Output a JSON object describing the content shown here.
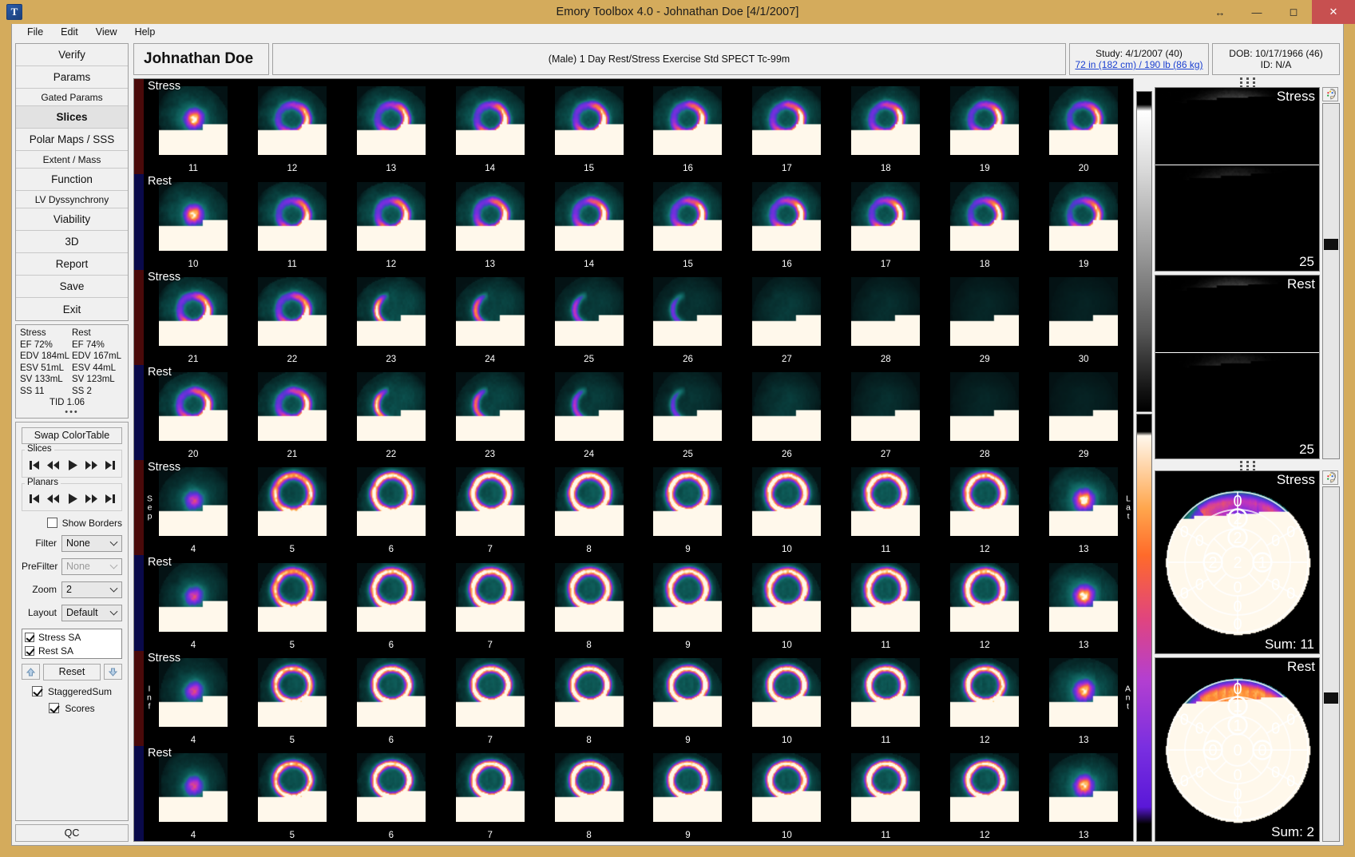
{
  "window": {
    "title": "Emory Toolbox 4.0 - Johnathan Doe [4/1/2007]",
    "app_icon": "T",
    "controls": {
      "resize": "resize-icon",
      "minimize": "minimize-icon",
      "maximize": "maximize-icon",
      "close": "close-icon"
    }
  },
  "menu": {
    "items": [
      "File",
      "Edit",
      "View",
      "Help"
    ]
  },
  "sidebar": {
    "nav": [
      {
        "label": "Verify",
        "size": "big",
        "active": false
      },
      {
        "label": "Params",
        "size": "big",
        "active": false
      },
      {
        "label": "Gated Params",
        "size": "sub",
        "active": false
      },
      {
        "label": "Slices",
        "size": "big",
        "active": true
      },
      {
        "label": "Polar Maps / SSS",
        "size": "big",
        "active": false
      },
      {
        "label": "Extent / Mass",
        "size": "sub",
        "active": false
      },
      {
        "label": "Function",
        "size": "big",
        "active": false
      },
      {
        "label": "LV Dyssynchrony",
        "size": "sub",
        "active": false
      },
      {
        "label": "Viability",
        "size": "big",
        "active": false
      },
      {
        "label": "3D",
        "size": "big",
        "active": false
      },
      {
        "label": "Report",
        "size": "big",
        "active": false
      },
      {
        "label": "Save",
        "size": "big",
        "active": false
      },
      {
        "label": "Exit",
        "size": "big",
        "active": false
      }
    ],
    "stats": {
      "col1_header": "Stress",
      "col2_header": "Rest",
      "col1": [
        "EF 72%",
        "EDV 184mL",
        "ESV 51mL",
        "SV 133mL",
        "SS 11"
      ],
      "col2": [
        "EF 74%",
        "EDV 167mL",
        "ESV 44mL",
        "SV 123mL",
        "SS 2"
      ],
      "tid": "TID 1.06",
      "more": "•••"
    },
    "controls": {
      "swap_colortable": "Swap ColorTable",
      "slices_legend": "Slices",
      "planars_legend": "Planars",
      "transport": [
        "skip-first-icon",
        "rewind-icon",
        "play-icon",
        "fast-forward-icon",
        "skip-last-icon"
      ],
      "show_borders": {
        "label": "Show Borders",
        "checked": false
      },
      "filter": {
        "label": "Filter",
        "value": "None",
        "disabled": false
      },
      "prefilter": {
        "label": "PreFilter",
        "value": "None",
        "disabled": true
      },
      "zoom": {
        "label": "Zoom",
        "value": "2",
        "disabled": false
      },
      "layout": {
        "label": "Layout",
        "value": "Default",
        "disabled": false
      },
      "series": [
        {
          "label": "Stress SA",
          "checked": true
        },
        {
          "label": "Rest SA",
          "checked": true
        }
      ],
      "move_up": "arrow-up-icon",
      "move_down": "arrow-down-icon",
      "reset": "Reset",
      "staggered_sum": {
        "label": "StaggeredSum",
        "checked": true
      },
      "scores": {
        "label": "Scores",
        "checked": true
      },
      "qc": "QC"
    }
  },
  "patient": {
    "name": "Johnathan Doe",
    "study_description": "(Male) 1 Day Rest/Stress Exercise Std SPECT Tc-99m",
    "study_line1": "Study: 4/1/2007 (40)",
    "study_line2": "72 in (182 cm) / 190 lb (86 kg)",
    "dob_line1": "DOB: 10/17/1966 (46)",
    "dob_line2": "ID: N/A"
  },
  "slice_rows": [
    {
      "title": "Stress",
      "tab": "stress",
      "view": "SA",
      "numbers": [
        "11",
        "12",
        "13",
        "14",
        "15",
        "16",
        "17",
        "18",
        "19",
        "20"
      ],
      "left_axis": "",
      "right_axis": ""
    },
    {
      "title": "Rest",
      "tab": "rest",
      "view": "SA",
      "numbers": [
        "10",
        "11",
        "12",
        "13",
        "14",
        "15",
        "16",
        "17",
        "18",
        "19"
      ],
      "left_axis": "",
      "right_axis": ""
    },
    {
      "title": "Stress",
      "tab": "stress",
      "view": "SA2",
      "numbers": [
        "21",
        "22",
        "23",
        "24",
        "25",
        "26",
        "27",
        "28",
        "29",
        "30"
      ],
      "left_axis": "",
      "right_axis": ""
    },
    {
      "title": "Rest",
      "tab": "rest",
      "view": "SA2",
      "numbers": [
        "20",
        "21",
        "22",
        "23",
        "24",
        "25",
        "26",
        "27",
        "28",
        "29"
      ],
      "left_axis": "",
      "right_axis": ""
    },
    {
      "title": "Stress",
      "tab": "stress",
      "view": "VLA",
      "numbers": [
        "4",
        "5",
        "6",
        "7",
        "8",
        "9",
        "10",
        "11",
        "12",
        "13"
      ],
      "left_axis": "Sep",
      "right_axis": "Lat"
    },
    {
      "title": "Rest",
      "tab": "rest",
      "view": "VLA",
      "numbers": [
        "4",
        "5",
        "6",
        "7",
        "8",
        "9",
        "10",
        "11",
        "12",
        "13"
      ],
      "left_axis": "",
      "right_axis": ""
    },
    {
      "title": "Stress",
      "tab": "stress",
      "view": "HLA",
      "numbers": [
        "4",
        "5",
        "6",
        "7",
        "8",
        "9",
        "10",
        "11",
        "12",
        "13"
      ],
      "left_axis": "Inf",
      "right_axis": "Ant"
    },
    {
      "title": "Rest",
      "tab": "rest",
      "view": "HLA",
      "numbers": [
        "4",
        "5",
        "6",
        "7",
        "8",
        "9",
        "10",
        "11",
        "12",
        "13"
      ],
      "left_axis": "",
      "right_axis": ""
    }
  ],
  "planars": [
    {
      "label": "Stress",
      "frame": "25"
    },
    {
      "label": "Rest",
      "frame": "25"
    }
  ],
  "polar_maps": [
    {
      "label": "Stress",
      "sum_label": "Sum: 11",
      "scores": {
        "apex": "2",
        "mid_inner": [
          "2",
          "1",
          "0",
          "2"
        ],
        "mid": [
          "2",
          "0",
          "0",
          "0",
          "0",
          "0"
        ],
        "outer": [
          "0",
          "0",
          "0",
          "0",
          "0",
          "0"
        ]
      },
      "highlighted": [
        "apex-north-1",
        "apex-north-2",
        "mid-lat",
        "apex-center-right"
      ]
    },
    {
      "label": "Rest",
      "sum_label": "Sum: 2",
      "scores": {
        "apex": "0",
        "mid_inner": [
          "1",
          "0",
          "0",
          "0"
        ],
        "mid": [
          "1",
          "0",
          "0",
          "0",
          "0",
          "0"
        ],
        "outer": [
          "0",
          "0",
          "0",
          "0",
          "0",
          "0"
        ]
      },
      "highlighted": [
        "apex-north-1",
        "apex-north-2"
      ]
    }
  ],
  "colors": {
    "titlebar": "#d4ab5c",
    "close_button": "#c75050",
    "stress_tab": "#4a0a0a",
    "rest_tab": "#0a0a4a",
    "link": "#1a3fd0",
    "panel": "#f0f0f0"
  }
}
